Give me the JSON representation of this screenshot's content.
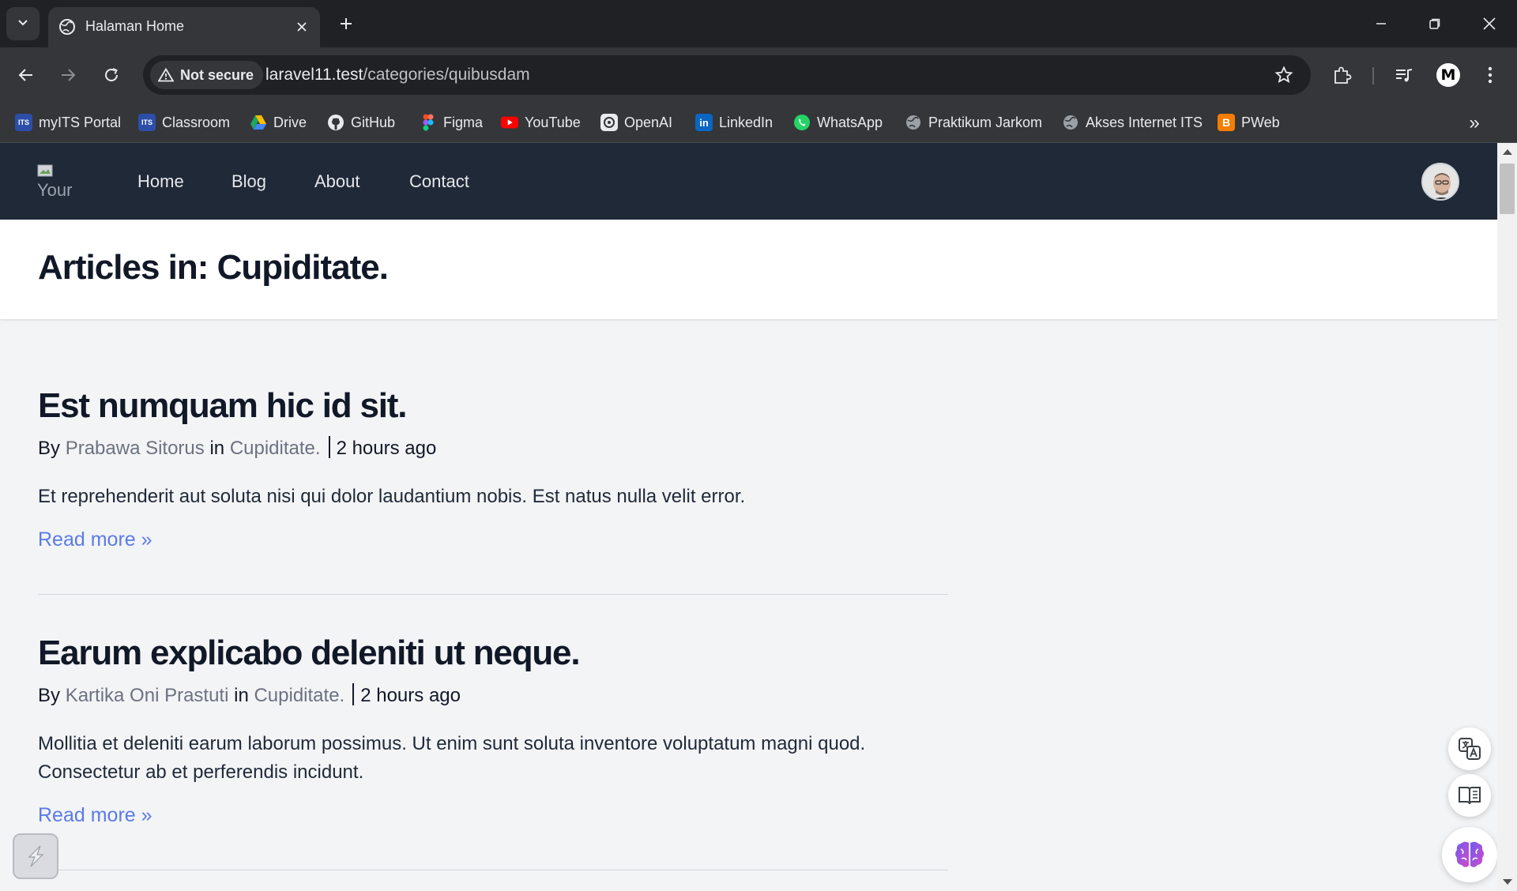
{
  "browser": {
    "tab_title": "Halaman Home",
    "security_label": "Not secure",
    "url_host": "laravel11.test",
    "url_path": "/categories/quibusdam",
    "profile_initial": "M"
  },
  "bookmarks": [
    {
      "label": "myITS Portal",
      "icon": "its-icon",
      "color": "#2b4fa8",
      "glyph": "ITS"
    },
    {
      "label": "Classroom",
      "icon": "its-icon",
      "color": "#2b4fa8",
      "glyph": "ITS"
    },
    {
      "label": "Drive",
      "icon": "drive-icon",
      "color": "#1fa463",
      "glyph": "▲"
    },
    {
      "label": "GitHub",
      "icon": "github-icon",
      "color": "#ffffff",
      "glyph": "●"
    },
    {
      "label": "Figma",
      "icon": "figma-icon",
      "color": "#f24e1e",
      "glyph": "✦"
    },
    {
      "label": "YouTube",
      "icon": "youtube-icon",
      "color": "#ff0000",
      "glyph": "▶"
    },
    {
      "label": "OpenAI",
      "icon": "openai-icon",
      "color": "#ffffff",
      "glyph": "✿"
    },
    {
      "label": "LinkedIn",
      "icon": "linkedin-icon",
      "color": "#0a66c2",
      "glyph": "in"
    },
    {
      "label": "WhatsApp",
      "icon": "whatsapp-icon",
      "color": "#25d366",
      "glyph": "✆"
    },
    {
      "label": "Praktikum Jarkom",
      "icon": "globe-icon",
      "color": "#9aa0a6",
      "glyph": "◍"
    },
    {
      "label": "Akses Internet ITS",
      "icon": "globe-icon",
      "color": "#9aa0a6",
      "glyph": "◍"
    },
    {
      "label": "PWeb",
      "icon": "blogger-icon",
      "color": "#f57d00",
      "glyph": "B"
    }
  ],
  "site": {
    "logo_alt": "Your",
    "nav": [
      "Home",
      "Blog",
      "About",
      "Contact"
    ]
  },
  "page": {
    "title": "Articles in: Cupiditate."
  },
  "articles": [
    {
      "title": "Est numquam hic id sit.",
      "by": "By",
      "author": "Prabawa Sitorus",
      "in": "in",
      "category": "Cupiditate.",
      "time": "2 hours ago",
      "excerpt": "Et reprehenderit aut soluta nisi qui dolor laudantium nobis. Est natus nulla velit error.",
      "read_more": "Read more »"
    },
    {
      "title": "Earum explicabo deleniti ut neque.",
      "by": "By",
      "author": "Kartika Oni Prastuti",
      "in": "in",
      "category": "Cupiditate.",
      "time": "2 hours ago",
      "excerpt": "Mollitia et deleniti earum laborum possimus. Ut enim sunt soluta inventore voluptatum magni quod. Consectetur ab et perferendis incidunt.",
      "read_more": "Read more »"
    }
  ],
  "colors": {
    "nav_bg": "#1f2937",
    "link": "#5b7be6",
    "page_bg": "#f3f4f6"
  }
}
